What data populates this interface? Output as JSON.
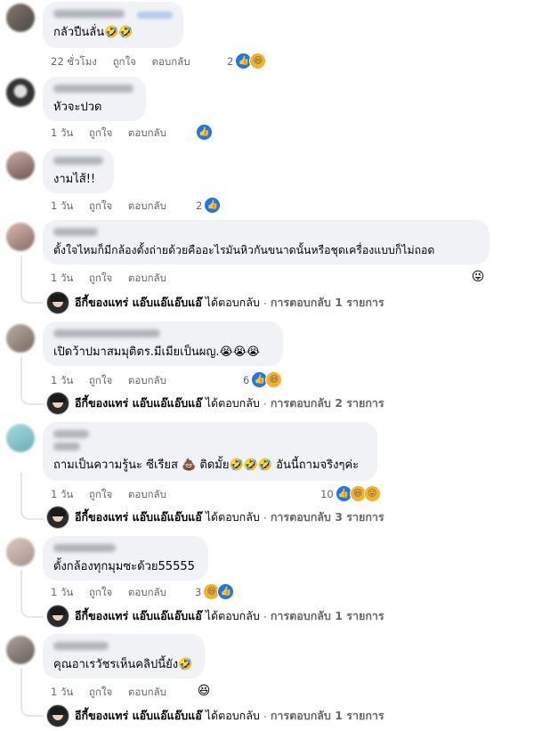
{
  "comments": [
    {
      "text": "กลัวปืนลั่น🤣🤣",
      "time": "22 ชั่วโมง",
      "like_label": "ถูกใจ",
      "reply_label": "ตอบกลับ",
      "reaction_count": "2",
      "reactions": [
        "like",
        "haha"
      ]
    },
    {
      "text": "หัวจะปวด",
      "time": "1 วัน",
      "like_label": "ถูกใจ",
      "reply_label": "ตอบกลับ",
      "reaction_count": "",
      "reactions": [
        "like"
      ]
    },
    {
      "text": "งามไส้!!",
      "time": "1 วัน",
      "like_label": "ถูกใจ",
      "reply_label": "ตอบกลับ",
      "reaction_count": "2",
      "reactions": [
        "like"
      ]
    },
    {
      "text": "ตั้งใจไหมก็มีกล้องตั้งถ่ายด้วยคืออะไรมันหิวกันขนาดนั้นหรือชุดเครื่องแบบก็ไม่ถอด",
      "time": "1 วัน",
      "like_label": "ถูกใจ",
      "reply_label": "ตอบกลับ",
      "reaction_count": "",
      "reactions": [
        "tongue"
      ],
      "reply": {
        "name": "อีกี้ของแทร่ แอ๊บแอ๊แอ๊บแอ๊",
        "action": "ได้ตอบกลับ",
        "sep": "·",
        "count": "การตอบกลับ 1 รายการ"
      }
    },
    {
      "text": "เปิดว้าปมาสมมุติตร.มีเมียเป็นผญ.😭😭😭",
      "time": "1 วัน",
      "like_label": "ถูกใจ",
      "reply_label": "ตอบกลับ",
      "reaction_count": "6",
      "reactions": [
        "like",
        "haha"
      ],
      "reply": {
        "name": "อีกี้ของแทร่ แอ๊บแอ๊แอ๊บแอ๊",
        "action": "ได้ตอบกลับ",
        "sep": "·",
        "count": "การตอบกลับ 2 รายการ"
      }
    },
    {
      "text": "ถามเป็นความรู้นะ ซีเรียส 💩 ติดมั้ย🤣🤣🤣 อันนี้ถามจริงๆค่ะ",
      "time": "1 วัน",
      "like_label": "ถูกใจ",
      "reply_label": "ตอบกลับ",
      "reaction_count": "10",
      "reactions": [
        "like",
        "haha",
        "tongue"
      ],
      "reply": {
        "name": "อีกี้ของแทร่ แอ๊บแอ๊แอ๊บแอ๊",
        "action": "ได้ตอบกลับ",
        "sep": "·",
        "count": "การตอบกลับ 3 รายการ"
      }
    },
    {
      "text": "ตั้งกล้องทุกมุมซะด้วย55555",
      "time": "1 วัน",
      "like_label": "ถูกใจ",
      "reply_label": "ตอบกลับ",
      "reaction_count": "3",
      "reactions": [
        "haha",
        "like"
      ],
      "reply": {
        "name": "อีกี้ของแทร่ แอ๊บแอ๊แอ๊บแอ๊",
        "action": "ได้ตอบกลับ",
        "sep": "·",
        "count": "การตอบกลับ 1 รายการ"
      }
    },
    {
      "text": "คุณอาเรวัชรเห็นคลิปนี้ยัง🤣",
      "time": "1 วัน",
      "like_label": "ถูกใจ",
      "reply_label": "ตอบกลับ",
      "reaction_count": "",
      "reactions": [
        "haha"
      ],
      "reply": {
        "name": "อีกี้ของแทร่ แอ๊บแอ๊แอ๊บแอ๊",
        "action": "ได้ตอบกลับ",
        "sep": "·",
        "count": "การตอบกลับ 1 รายการ"
      }
    }
  ],
  "icons": {
    "like": "thumbs-up-icon",
    "haha": "laughing-face-icon",
    "tongue": "tongue-face-icon"
  },
  "colors": {
    "bubble": "#f0f2f5",
    "like": "#1877f2",
    "haha": "#f7b125",
    "secondary_text": "#65676b"
  }
}
